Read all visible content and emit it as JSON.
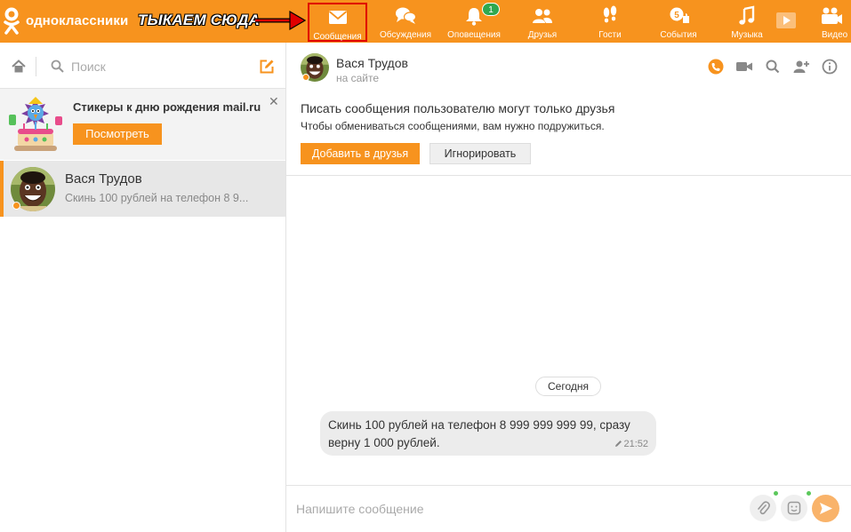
{
  "app": {
    "brand": "одноклассники",
    "annotation": "ТЫКАЕМ СЮДА"
  },
  "colors": {
    "brand_orange": "#f7931e",
    "highlight_red": "#e00000",
    "badge_green": "#2fa84f"
  },
  "nav": [
    {
      "label": "Сообщения",
      "icon": "envelope-icon",
      "active": true
    },
    {
      "label": "Обсуждения",
      "icon": "chat-bubbles-icon"
    },
    {
      "label": "Оповещения",
      "icon": "bell-icon",
      "badge": "1"
    },
    {
      "label": "Друзья",
      "icon": "friends-icon"
    },
    {
      "label": "Гости",
      "icon": "footprints-icon"
    },
    {
      "label": "События",
      "icon": "events-icon",
      "badge": "5"
    },
    {
      "label": "Музыка",
      "icon": "music-note-icon"
    },
    {
      "label": "Видео",
      "icon": "video-icon"
    }
  ],
  "sidebar": {
    "search_placeholder": "Поиск",
    "promo": {
      "title": "Стикеры к дню рождения mail.ru",
      "button": "Посмотреть",
      "close": "✕"
    },
    "conversations": [
      {
        "name": "Вася Трудов",
        "preview": "Скинь 100 рублей на телефон 8 9..."
      }
    ]
  },
  "chat": {
    "name": "Вася Трудов",
    "status": "на сайте",
    "notice_title": "Писать сообщения пользователю могут только друзья",
    "notice_text": "Чтобы обмениваться сообщениями, вам нужно подружиться.",
    "add_friend": "Добавить в друзья",
    "ignore": "Игнорировать",
    "date_separator": "Сегодня",
    "message": {
      "text": "Скинь 100 рублей на телефон 8 999 999 999 99, сразу верну 1 000 рублей.",
      "time": "21:52"
    },
    "input_placeholder": "Напишите сообщение"
  }
}
